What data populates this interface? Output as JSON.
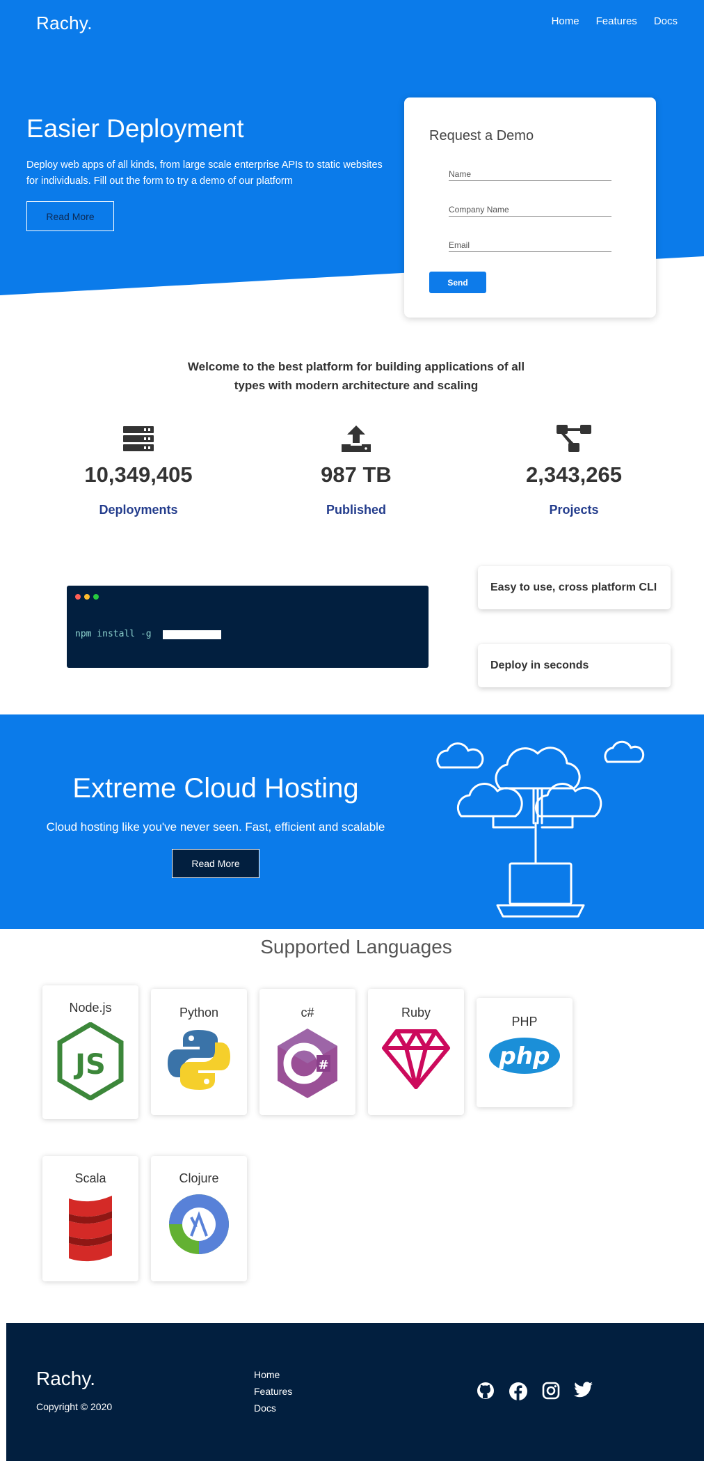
{
  "header": {
    "brand": "Rachy.",
    "nav": [
      "Home",
      "Features",
      "Docs"
    ]
  },
  "hero": {
    "title": "Easier Deployment",
    "description": "Deploy web apps of all kinds, from large scale enterprise APIs to static websites for individuals. Fill out the form to try a demo of our platform",
    "button": "Read More"
  },
  "demo_form": {
    "title": "Request a Demo",
    "name_placeholder": "Name",
    "company_placeholder": "Company Name",
    "email_placeholder": "Email",
    "send": "Send"
  },
  "welcome": "Welcome to the best platform for building applications of all types with modern architecture and scaling",
  "stats": [
    {
      "icon": "server-icon",
      "value": "10,349,405",
      "label": "Deployments"
    },
    {
      "icon": "upload-icon",
      "value": "987 TB",
      "label": "Published"
    },
    {
      "icon": "project-diagram-icon",
      "value": "2,343,265",
      "label": "Projects"
    }
  ],
  "terminal": {
    "command": "npm install -g"
  },
  "features": [
    "Easy to use, cross platform CLI",
    "Deploy in seconds"
  ],
  "cloud": {
    "title": "Extreme Cloud Hosting",
    "description": "Cloud hosting like you've never seen. Fast, efficient and scalable",
    "button": "Read More"
  },
  "languages": {
    "title": "Supported Languages",
    "items": [
      {
        "name": "Node.js",
        "icon": "nodejs-icon"
      },
      {
        "name": "Python",
        "icon": "python-icon"
      },
      {
        "name": "c#",
        "icon": "csharp-icon"
      },
      {
        "name": "Ruby",
        "icon": "ruby-icon"
      },
      {
        "name": "PHP",
        "icon": "php-icon"
      },
      {
        "name": "Scala",
        "icon": "scala-icon"
      },
      {
        "name": "Clojure",
        "icon": "clojure-icon"
      }
    ]
  },
  "footer": {
    "brand": "Rachy.",
    "copyright": "Copyright © 2020",
    "links": [
      "Home",
      "Features",
      "Docs"
    ],
    "social": [
      "github-icon",
      "facebook-icon",
      "instagram-icon",
      "twitter-icon"
    ]
  },
  "colors": {
    "primary": "#0b7bea",
    "dark": "#021f3f",
    "stat_label": "#233c8c"
  }
}
